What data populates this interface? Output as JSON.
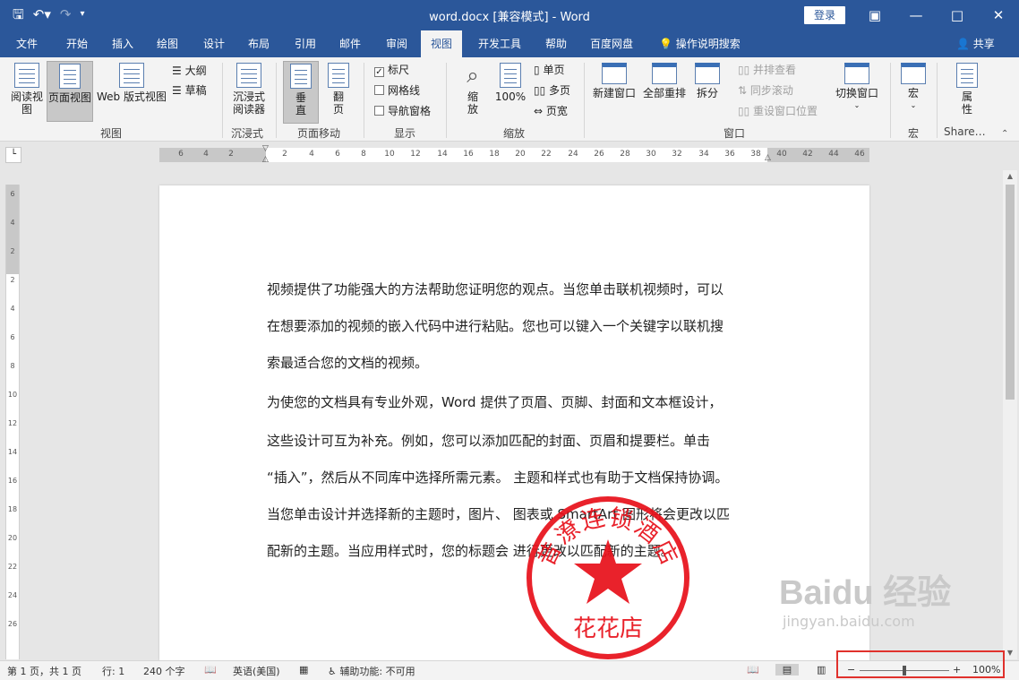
{
  "window": {
    "title": "word.docx [兼容模式]  -  Word",
    "login_label": "登录"
  },
  "tabs": [
    {
      "label": "文件"
    },
    {
      "label": "开始"
    },
    {
      "label": "插入"
    },
    {
      "label": "绘图"
    },
    {
      "label": "设计"
    },
    {
      "label": "布局"
    },
    {
      "label": "引用"
    },
    {
      "label": "邮件"
    },
    {
      "label": "审阅"
    },
    {
      "label": "视图"
    },
    {
      "label": "开发工具"
    },
    {
      "label": "帮助"
    },
    {
      "label": "百度网盘"
    }
  ],
  "help_search": "操作说明搜索",
  "share_label": "共享",
  "ribbon": {
    "view_group": {
      "read_mode": "阅读视图",
      "print_layout": "页面视图",
      "web_layout": "Web 版式视图",
      "outline": "大纲",
      "draft": "草稿",
      "label": "视图"
    },
    "immersive_group": {
      "reader": "沉浸式阅读器",
      "label": "沉浸式"
    },
    "page_move_group": {
      "vertical": "垂直",
      "side": "翻页",
      "label": "页面移动"
    },
    "show_group": {
      "ruler": "标尺",
      "gridlines": "网格线",
      "nav_pane": "导航窗格",
      "label": "显示"
    },
    "zoom_group": {
      "zoom": "缩放",
      "percent": "100%",
      "one_page": "单页",
      "multi_page": "多页",
      "page_width": "页宽",
      "label": "缩放"
    },
    "window_group": {
      "new_window": "新建窗口",
      "arrange_all": "全部重排",
      "split": "拆分",
      "side_by_side": "并排查看",
      "sync_scroll": "同步滚动",
      "reset_pos": "重设窗口位置",
      "switch": "切换窗口",
      "label": "窗口"
    },
    "macro_group": {
      "macro": "宏",
      "label": "宏"
    },
    "sharepoint_group": {
      "props": "属性",
      "label": "SharePoint"
    }
  },
  "ruler": {
    "h_ticks": [
      "6",
      "4",
      "2",
      "2",
      "4",
      "6",
      "8",
      "10",
      "12",
      "14",
      "16",
      "18",
      "20",
      "22",
      "24",
      "26",
      "28",
      "30",
      "32",
      "34",
      "36",
      "38",
      "40",
      "42",
      "44",
      "46"
    ],
    "v_ticks": [
      "6",
      "4",
      "2",
      "2",
      "4",
      "6",
      "8",
      "10",
      "12",
      "14",
      "16",
      "18",
      "20",
      "22",
      "24",
      "26"
    ]
  },
  "document": {
    "paragraphs": [
      "视频提供了功能强大的方法帮助您证明您的观点。当您单击联机视频时，可以",
      "在想要添加的视频的嵌入代码中进行粘贴。您也可以键入一个关键字以联机搜",
      "索最适合您的文档的视频。",
      "为使您的文档具有专业外观，Word 提供了页眉、页脚、封面和文本框设计，",
      "这些设计可互为补充。例如，您可以添加匹配的封面、页眉和提要栏。单击",
      "“插入”，然后从不同库中选择所需元素。 主题和样式也有助于文档保持协调。",
      "当您单击设计并选择新的主题时，图片、 图表或 SmartArt 图形将会更改以匹",
      "配新的主题。当应用样式时，您的标题会 进行更改以匹配新的主题。"
    ],
    "stamp": {
      "ring_text": "昔潦连锁酒店",
      "center_text": "花花店",
      "color": "#e8101a"
    }
  },
  "status": {
    "page": "第 1 页，共 1 页",
    "line": "行: 1",
    "words": "240 个字",
    "language": "英语(美国)",
    "accessibility": "辅助功能: 不可用",
    "zoom_percent": "100%",
    "zoom_level": 0.5
  },
  "watermark": {
    "brand": "Baidu 经验",
    "url": "jingyan.baidu.com"
  },
  "colors": {
    "accent": "#2b579a",
    "highlight": "#e0312c"
  }
}
